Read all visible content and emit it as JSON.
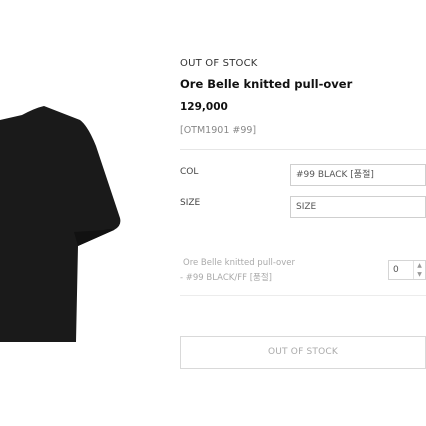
{
  "product": {
    "stock_status": "OUT OF STOCK",
    "name": "Ore Belle knitted pull-over",
    "price": "129,000",
    "sku": "[OTM1901 #99]"
  },
  "options": {
    "color_label": "COL",
    "color_value": "#99 BLACK [품절]",
    "size_label": "SIZE",
    "size_value": "SIZE"
  },
  "selected_item": {
    "name": "Ore Belle knitted pull-over",
    "option": "- #99 BLACK/FF [품절]",
    "quantity": "0"
  },
  "actions": {
    "out_of_stock_label": "OUT OF STOCK"
  },
  "colors": {
    "garment": "#1a1a1a",
    "border": "#cfcfcf",
    "muted_text": "#aaaaaa"
  }
}
